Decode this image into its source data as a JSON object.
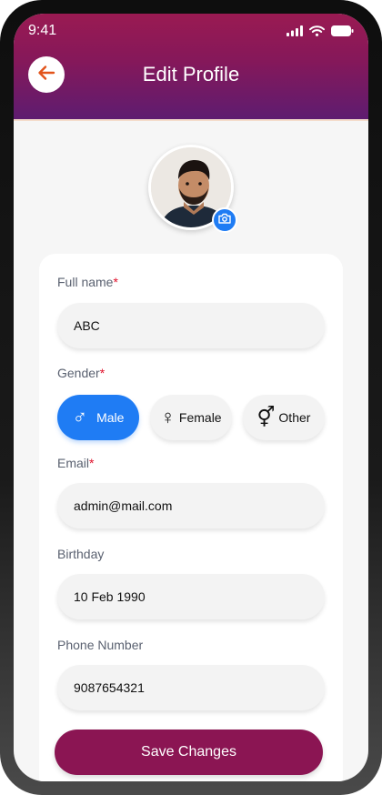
{
  "status_bar": {
    "time": "9:41"
  },
  "header": {
    "title": "Edit Profile"
  },
  "form": {
    "full_name": {
      "label": "Full name",
      "required_mark": "*",
      "value": "ABC"
    },
    "gender": {
      "label": "Gender",
      "required_mark": "*",
      "options": [
        {
          "label": "Male",
          "symbol": "♂",
          "selected": true
        },
        {
          "label": "Female",
          "symbol": "♀",
          "selected": false
        },
        {
          "label": "Other",
          "symbol": "⚥",
          "selected": false
        }
      ]
    },
    "email": {
      "label": "Email",
      "required_mark": "*",
      "value": "admin@mail.com"
    },
    "birthday": {
      "label": "Birthday",
      "value": "10 Feb 1990"
    },
    "phone": {
      "label": "Phone Number",
      "value": "9087654321"
    }
  },
  "save_button": {
    "label": "Save Changes"
  },
  "colors": {
    "header_gradient_top": "#9a1a52",
    "header_gradient_bottom": "#5e1c70",
    "accent_blue": "#1f7cf4",
    "save_button": "#8b1553",
    "back_arrow": "#e2541b",
    "required": "#e0102a"
  },
  "icons": {
    "back": "arrow-left-icon",
    "camera": "camera-icon",
    "signal": "signal-icon",
    "wifi": "wifi-icon",
    "battery": "battery-icon"
  }
}
